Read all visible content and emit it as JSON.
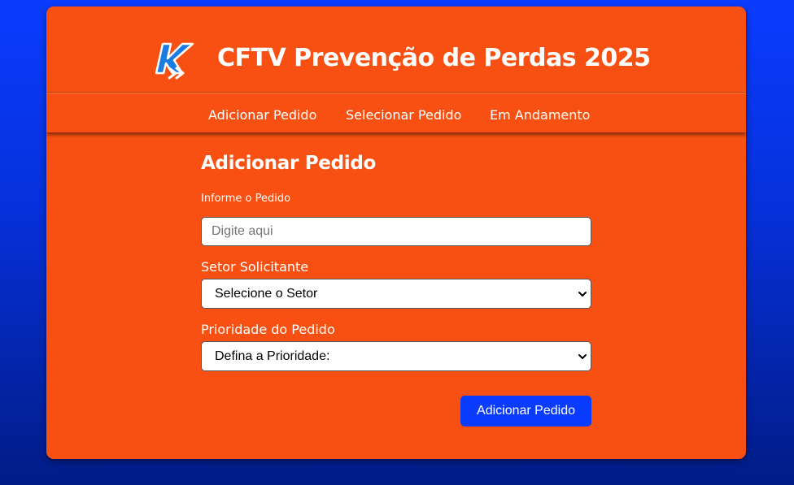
{
  "header": {
    "title": "CFTV Prevenção de Perdas 2025",
    "logo_icon": "k-arrows-logo-icon"
  },
  "nav": {
    "items": [
      {
        "label": "Adicionar Pedido"
      },
      {
        "label": "Selecionar Pedido"
      },
      {
        "label": "Em Andamento"
      }
    ]
  },
  "form": {
    "heading": "Adicionar Pedido",
    "order_label": "Informe o Pedido",
    "order_placeholder": "Digite aqui",
    "order_value": "",
    "sector_label": "Setor Solicitante",
    "sector_selected": "Selecione o Setor",
    "priority_label": "Prioridade do Pedido",
    "priority_selected": "Defina a Prioridade:",
    "submit_label": "Adicionar Pedido"
  },
  "colors": {
    "card_bg": "#f75012",
    "page_bg_top": "#0a3cff",
    "page_bg_bottom": "#011c86",
    "button_bg": "#0a3cff",
    "text": "#ffffff"
  }
}
